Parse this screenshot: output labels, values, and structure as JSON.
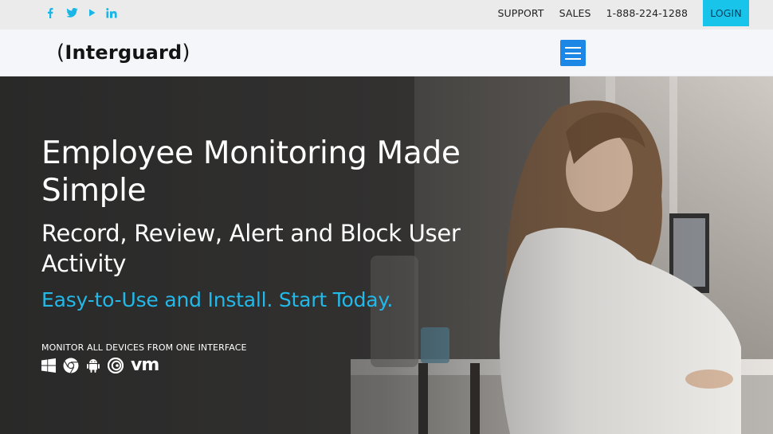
{
  "topbar": {
    "socials": [
      {
        "icon": "facebook-icon",
        "glyph": "f"
      },
      {
        "icon": "twitter-icon",
        "glyph": "twitter"
      },
      {
        "icon": "youtube-icon",
        "glyph": "play"
      },
      {
        "icon": "linkedin-icon",
        "glyph": "in"
      }
    ],
    "nav": {
      "support": "SUPPORT",
      "sales": "SALES",
      "phone": "1-888-224-1288",
      "login": "LOGIN"
    },
    "accent_color": "#19c4ea"
  },
  "header": {
    "logo_open": "(",
    "logo_text": "Interguard",
    "logo_close": ")",
    "menu_icon": "hamburger-menu-icon",
    "menu_color": "#1d87e6"
  },
  "hero": {
    "title": "Employee Monitoring Made Simple",
    "subtitle": "Record, Review, Alert and Block User Activity",
    "tagline": "Easy-to-Use and Install. Start Today.",
    "devices_label": "MONITOR ALL DEVICES FROM ONE INTERFACE",
    "device_icons": [
      "windows-icon",
      "chrome-icon",
      "android-icon",
      "citrix-icon",
      "vmware-icon"
    ],
    "vmware_text": "vm",
    "tagline_color": "#22b8e8"
  }
}
